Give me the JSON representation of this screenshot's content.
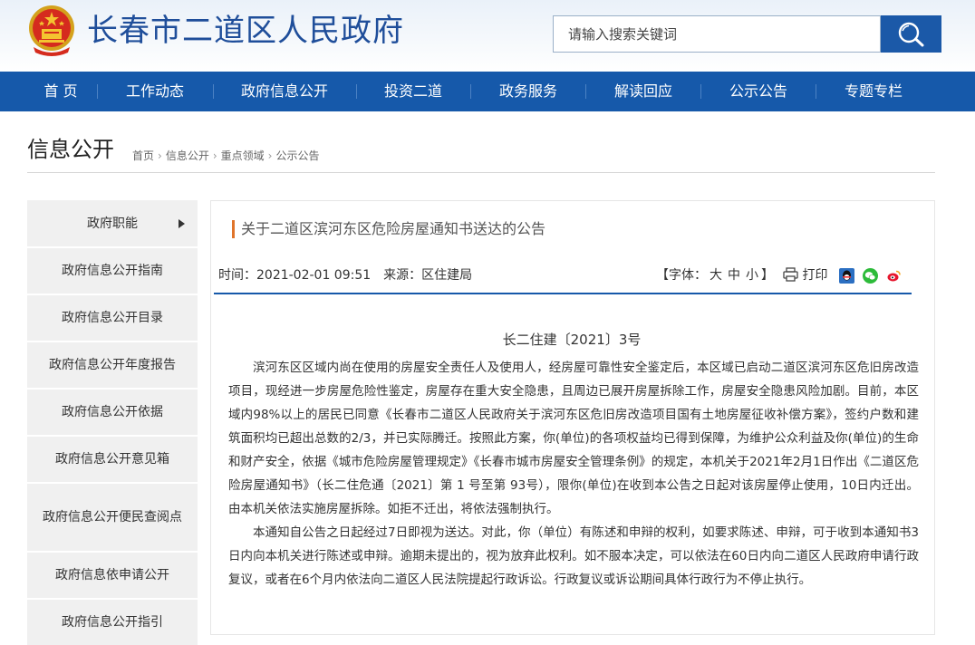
{
  "header": {
    "site_title": "长春市二道区人民政府",
    "search_placeholder": "请输入搜索关键词"
  },
  "colors": {
    "brand_blue": "#1659aa",
    "title_blue": "#1f4e9a",
    "accent_orange": "#e0742b",
    "sidebar_bg": "#f0f0f0"
  },
  "icons": {
    "emblem": "national-emblem",
    "search": "search-icon",
    "print": "printer-icon",
    "share": [
      "qq-icon",
      "wechat-icon",
      "weibo-icon"
    ]
  },
  "nav": {
    "items": [
      "首 页",
      "工作动态",
      "政府信息公开",
      "投资二道",
      "政务服务",
      "解读回应",
      "公示公告",
      "专题专栏"
    ]
  },
  "info": {
    "title": "信息公开",
    "breadcrumb": [
      "首页",
      "信息公开",
      "重点领域",
      "公示公告"
    ]
  },
  "sidebar": {
    "items": [
      "政府职能",
      "政府信息公开指南",
      "政府信息公开目录",
      "政府信息公开年度报告",
      "政府信息公开依据",
      "政府信息公开意见箱",
      "政府信息公开便民查阅点",
      "政府信息依申请公开",
      "政府信息公开指引"
    ]
  },
  "article": {
    "title": "关于二道区滨河东区危险房屋通知书送达的公告",
    "time": "时间：2021-02-01 09:51",
    "source": "来源：区住建局",
    "font_label_open": "【字体：",
    "font_large": "大",
    "font_medium": "中",
    "font_small": "小",
    "font_label_close": "】",
    "print_label": "打印",
    "doc_number": "长二住建〔2021〕3号",
    "paragraphs": [
      "滨河东区区域内尚在使用的房屋安全责任人及使用人，经房屋可靠性安全鉴定后，本区域已启动二道区滨河东区危旧房改造项目，现经进一步房屋危险性鉴定，房屋存在重大安全隐患，且周边已展开房屋拆除工作，房屋安全隐患风险加剧。目前，本区域内98%以上的居民已同意《长春市二道区人民政府关于滨河东区危旧房改造项目国有土地房屋征收补偿方案》，签约户数和建筑面积均已超出总数的2/3，并已实际腾迁。按照此方案，你(单位)的各项权益均已得到保障，为维护公众利益及你(单位)的生命和财产安全，依据《城市危险房屋管理规定》《长春市城市房屋安全管理条例》的规定，本机关于2021年2月1日作出《二道区危险房屋通知书》（长二住危通〔2021〕第 1 号至第 93号），限你(单位)在收到本公告之日起对该房屋停止使用，10日内迁出。由本机关依法实施房屋拆除。如拒不迁出，将依法强制执行。",
      "本通知自公告之日起经过7日即视为送达。对此，你（单位）有陈述和申辩的权利，如要求陈述、申辩，可于收到本通知书3日内向本机关进行陈述或申辩。逾期未提出的，视为放弃此权利。如不服本决定，可以依法在60日内向二道区人民政府申请行政复议，或者在6个月内依法向二道区人民法院提起行政诉讼。行政复议或诉讼期间具体行政行为不停止执行。"
    ]
  }
}
